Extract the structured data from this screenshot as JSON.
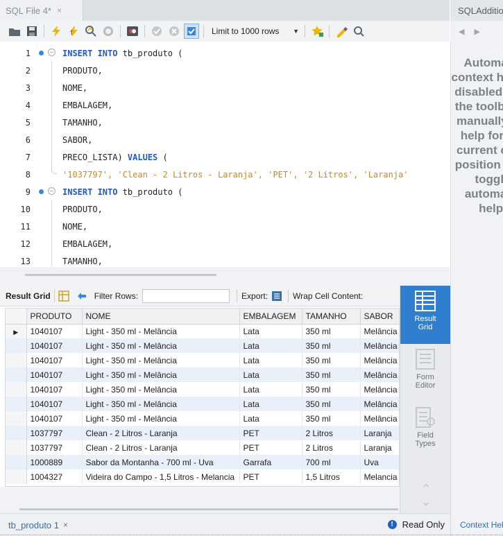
{
  "tabs": {
    "active": {
      "label": "SQL File 4*",
      "close": "×"
    }
  },
  "side_panel": {
    "header": "SQLAdditions",
    "nav": [
      "◀",
      "▶"
    ],
    "help_text": "Automatic context help is disabled. Use the toolbar to manually get help for the current caret position or to toggle automatic help.",
    "footer_tab": "Context Help"
  },
  "sql_toolbar": {
    "limit_label": "Limit to 1000 rows",
    "icons": [
      "folder-icon",
      "save-icon",
      "execute-icon",
      "execute-current-icon",
      "explain-icon",
      "stop-icon",
      "toggle-error-icon",
      "commit-icon",
      "rollback-icon",
      "autocommit-icon",
      "limit-select",
      "bookmark-star-icon",
      "beautify-icon",
      "find-icon"
    ]
  },
  "editor": {
    "lines": [
      {
        "n": "1",
        "dot": true,
        "fold": "−",
        "tokens": [
          {
            "t": "INSERT INTO",
            "c": "kw"
          },
          {
            "t": " tb_produto (",
            "c": "code"
          }
        ]
      },
      {
        "n": "2",
        "tokens": [
          {
            "t": "PRODUTO,",
            "c": "code"
          }
        ]
      },
      {
        "n": "3",
        "tokens": [
          {
            "t": "NOME,",
            "c": "code"
          }
        ]
      },
      {
        "n": "4",
        "tokens": [
          {
            "t": "EMBALAGEM,",
            "c": "code"
          }
        ]
      },
      {
        "n": "5",
        "tokens": [
          {
            "t": "TAMANHO,",
            "c": "code"
          }
        ]
      },
      {
        "n": "6",
        "tokens": [
          {
            "t": "SABOR,",
            "c": "code"
          }
        ]
      },
      {
        "n": "7",
        "tokens": [
          {
            "t": "PRECO_LISTA) ",
            "c": "code"
          },
          {
            "t": "VALUES",
            "c": "kw"
          },
          {
            "t": " (",
            "c": "code"
          }
        ]
      },
      {
        "n": "8",
        "end": true,
        "tokens": [
          {
            "t": "'1037797', 'Clean - 2 Litros - Laranja', 'PET', '2 Litros', 'Laranja'",
            "c": "str"
          }
        ]
      },
      {
        "n": "9",
        "dot": true,
        "fold": "−",
        "tokens": [
          {
            "t": "INSERT INTO",
            "c": "kw"
          },
          {
            "t": " tb_produto (",
            "c": "code"
          }
        ]
      },
      {
        "n": "10",
        "tokens": [
          {
            "t": "PRODUTO,",
            "c": "code"
          }
        ]
      },
      {
        "n": "11",
        "tokens": [
          {
            "t": "NOME,",
            "c": "code"
          }
        ]
      },
      {
        "n": "12",
        "tokens": [
          {
            "t": "EMBALAGEM,",
            "c": "code"
          }
        ]
      },
      {
        "n": "13",
        "tokens": [
          {
            "t": "TAMANHO,",
            "c": "code"
          }
        ]
      }
    ]
  },
  "result_toolbar": {
    "result_grid": "Result Grid",
    "filter_rows": "Filter Rows:",
    "filter_value": "",
    "export": "Export:",
    "wrap": "Wrap Cell Content:"
  },
  "grid": {
    "columns": [
      "PRODUTO",
      "NOME",
      "EMBALAGEM",
      "TAMANHO",
      "SABOR"
    ],
    "current_marker": "▶",
    "rows": [
      [
        "1040107",
        "Light - 350 ml - Melância",
        "Lata",
        "350 ml",
        "Melância"
      ],
      [
        "1040107",
        "Light - 350 ml - Melância",
        "Lata",
        "350 ml",
        "Melância"
      ],
      [
        "1040107",
        "Light - 350 ml - Melância",
        "Lata",
        "350 ml",
        "Melância"
      ],
      [
        "1040107",
        "Light - 350 ml - Melância",
        "Lata",
        "350 ml",
        "Melância"
      ],
      [
        "1040107",
        "Light - 350 ml - Melância",
        "Lata",
        "350 ml",
        "Melância"
      ],
      [
        "1040107",
        "Light - 350 ml - Melância",
        "Lata",
        "350 ml",
        "Melância"
      ],
      [
        "1040107",
        "Light - 350 ml - Melância",
        "Lata",
        "350 ml",
        "Melância"
      ],
      [
        "1037797",
        "Clean - 2 Litros - Laranja",
        "PET",
        "2 Litros",
        "Laranja"
      ],
      [
        "1037797",
        "Clean - 2 Litros - Laranja",
        "PET",
        "2 Litros",
        "Laranja"
      ],
      [
        "1000889",
        "Sabor da Montanha - 700 ml - Uva",
        "Garrafa",
        "700 ml",
        "Uva"
      ],
      [
        "1004327",
        "Videira do Campo - 1,5 Litros - Melancia",
        "PET",
        "1,5 Litros",
        "Melancia"
      ]
    ]
  },
  "modes": [
    {
      "label": "Result\nGrid",
      "active": true
    },
    {
      "label": "Form\nEditor",
      "active": false
    },
    {
      "label": "Field\nTypes",
      "active": false
    }
  ],
  "bottom": {
    "result_tab": "tb_produto 1",
    "close": "×",
    "readonly": "Read Only",
    "readonly_icon": "!"
  },
  "colors": {
    "accent": "#2f7fce",
    "keyword": "#2357c6",
    "string": "#c88a1a",
    "alt_row": "#e9f0fa"
  }
}
